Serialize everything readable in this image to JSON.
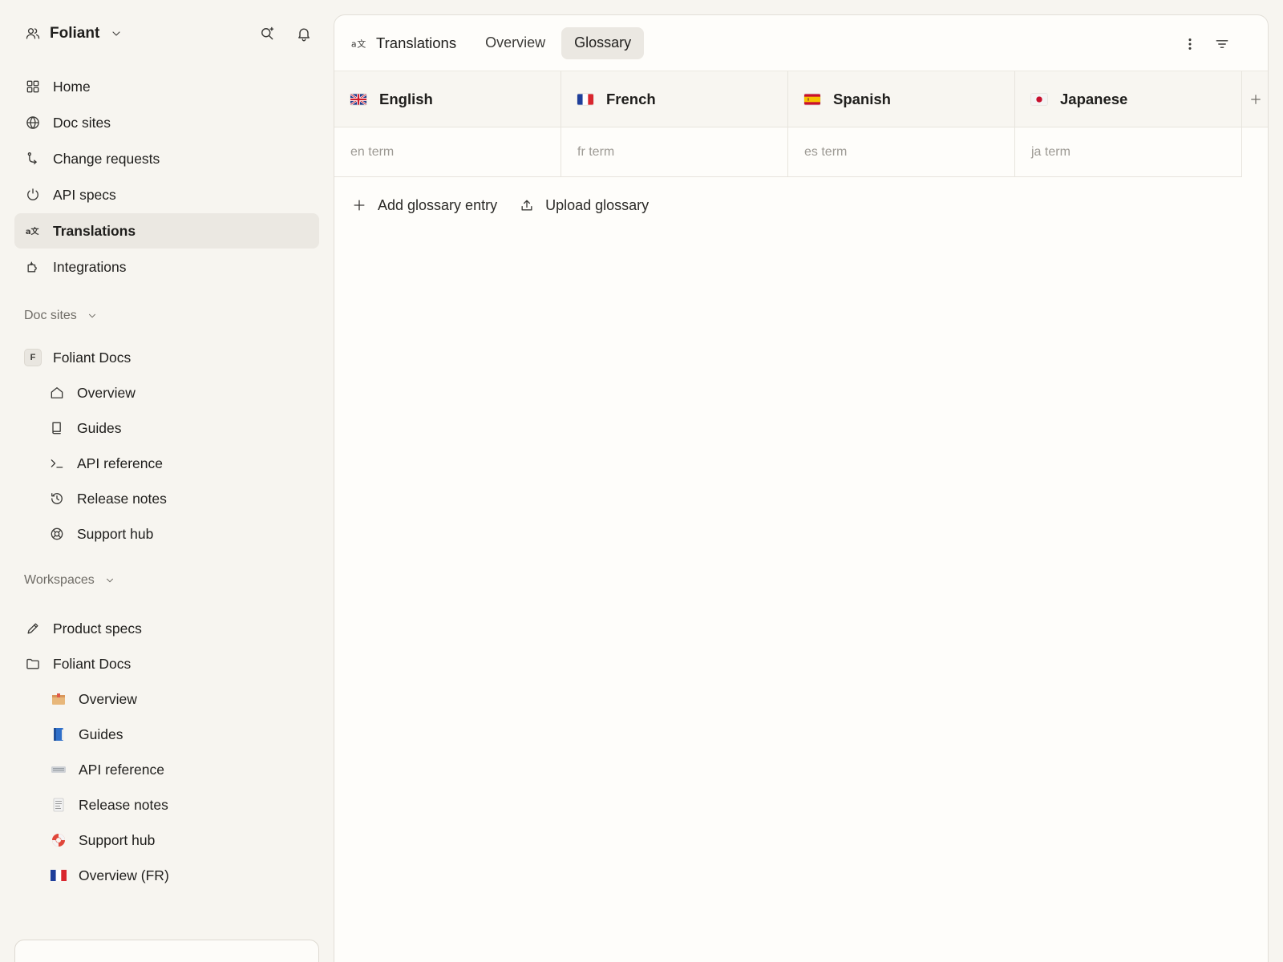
{
  "sidebar": {
    "org_name": "Foliant",
    "nav": [
      {
        "label": "Home",
        "icon": "grid-icon"
      },
      {
        "label": "Doc sites",
        "icon": "globe-icon"
      },
      {
        "label": "Change requests",
        "icon": "branch-icon"
      },
      {
        "label": "API specs",
        "icon": "power-icon"
      },
      {
        "label": "Translations",
        "icon": "translate-icon",
        "active": true
      },
      {
        "label": "Integrations",
        "icon": "puzzle-icon"
      }
    ],
    "doc_sites": {
      "heading": "Doc sites",
      "site_badge": "F",
      "site_name": "Foliant Docs",
      "children": [
        {
          "label": "Overview",
          "icon": "home-icon"
        },
        {
          "label": "Guides",
          "icon": "book-icon"
        },
        {
          "label": "API reference",
          "icon": "terminal-icon"
        },
        {
          "label": "Release notes",
          "icon": "history-icon"
        },
        {
          "label": "Support hub",
          "icon": "lifebuoy-icon"
        }
      ]
    },
    "workspaces": {
      "heading": "Workspaces",
      "items": [
        {
          "label": "Product specs",
          "icon": "pencil-icon"
        },
        {
          "label": "Foliant Docs",
          "icon": "folder-icon"
        }
      ],
      "children": [
        {
          "label": "Overview",
          "icon": "package-emoji-icon"
        },
        {
          "label": "Guides",
          "icon": "blue-book-emoji-icon"
        },
        {
          "label": "API reference",
          "icon": "keyboard-emoji-icon"
        },
        {
          "label": "Release notes",
          "icon": "notepad-emoji-icon"
        },
        {
          "label": "Support hub",
          "icon": "lifebuoy-emoji-icon"
        },
        {
          "label": "Overview (FR)",
          "icon": "flag-fr-icon"
        }
      ]
    }
  },
  "main": {
    "title": "Translations",
    "tabs": [
      {
        "label": "Overview",
        "active": false
      },
      {
        "label": "Glossary",
        "active": true
      }
    ],
    "columns": [
      {
        "label": "English",
        "flag": "flag-gb-icon",
        "placeholder": "en term"
      },
      {
        "label": "French",
        "flag": "flag-fr-icon",
        "placeholder": "fr term"
      },
      {
        "label": "Spanish",
        "flag": "flag-es-icon",
        "placeholder": "es term"
      },
      {
        "label": "Japanese",
        "flag": "flag-jp-icon",
        "placeholder": "ja term"
      }
    ],
    "actions": {
      "add_entry": "Add glossary entry",
      "upload": "Upload glossary"
    }
  },
  "colors": {
    "background": "#f7f5f0",
    "panel": "#fefdfa",
    "active_item": "#ebe8e2",
    "placeholder_text": "#9d9a94"
  }
}
